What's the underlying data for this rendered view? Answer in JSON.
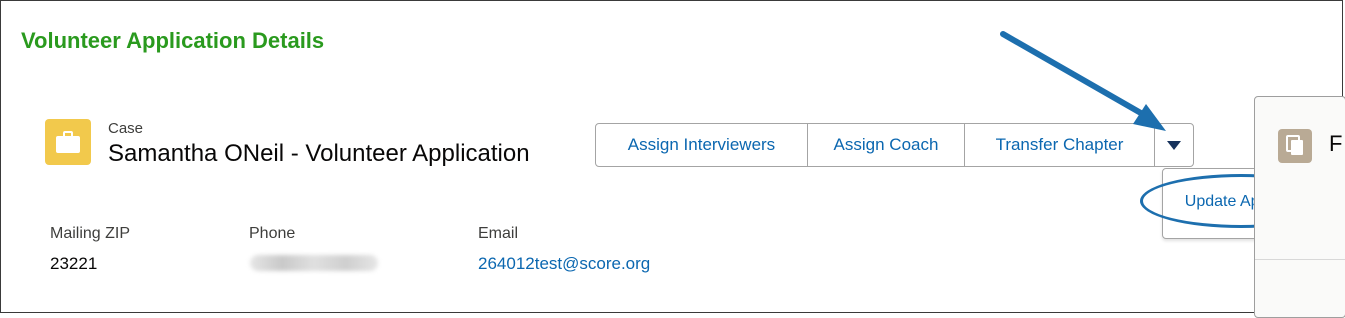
{
  "page": {
    "title": "Volunteer Application Details"
  },
  "record": {
    "type": "Case",
    "name": "Samantha ONeil - Volunteer Application"
  },
  "actions": {
    "assign_interviewers": "Assign Interviewers",
    "assign_coach": "Assign Coach",
    "transfer_chapter": "Transfer Chapter",
    "more_icon": "chevron-down-icon"
  },
  "dropdown": {
    "items": [
      "Update Application"
    ]
  },
  "fields": [
    {
      "label": "Mailing ZIP",
      "value": "23221"
    },
    {
      "label": "Phone",
      "value": ""
    },
    {
      "label": "Email",
      "value": "264012test@score.org"
    }
  ],
  "side_panel": {
    "letter": "F",
    "icon": "files-icon"
  },
  "colors": {
    "title_green": "#2a9a1e",
    "link_blue": "#0b67b0",
    "annotation_blue": "#1d6fae",
    "case_icon_yellow": "#f2c94c"
  }
}
